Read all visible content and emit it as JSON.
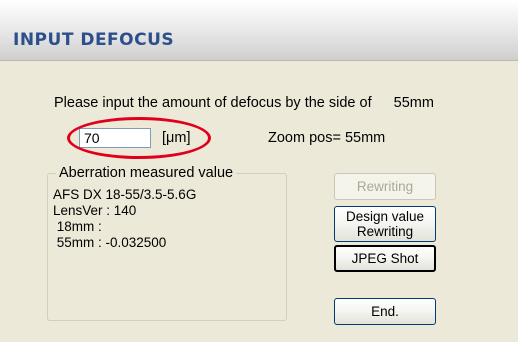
{
  "window": {
    "title": "INPUT DEFOCUS"
  },
  "prompt": {
    "text": "Please input the amount of defocus by the side of",
    "focal": "55mm"
  },
  "defocus": {
    "value": "70",
    "unit": "[μm]"
  },
  "zoom": {
    "label": "Zoom pos= 55mm"
  },
  "aberration": {
    "legend": "Aberration measured value",
    "lines": [
      "AFS DX 18-55/3.5-5.6G",
      "LensVer : 140",
      " 18mm :",
      " 55mm : -0.032500"
    ]
  },
  "buttons": {
    "rewriting": "Rewriting",
    "design_line1": "Design value",
    "design_line2": "Rewriting",
    "jpeg": "JPEG Shot",
    "end": "End."
  },
  "annotation": {
    "highlight_color": "#e0001b"
  }
}
